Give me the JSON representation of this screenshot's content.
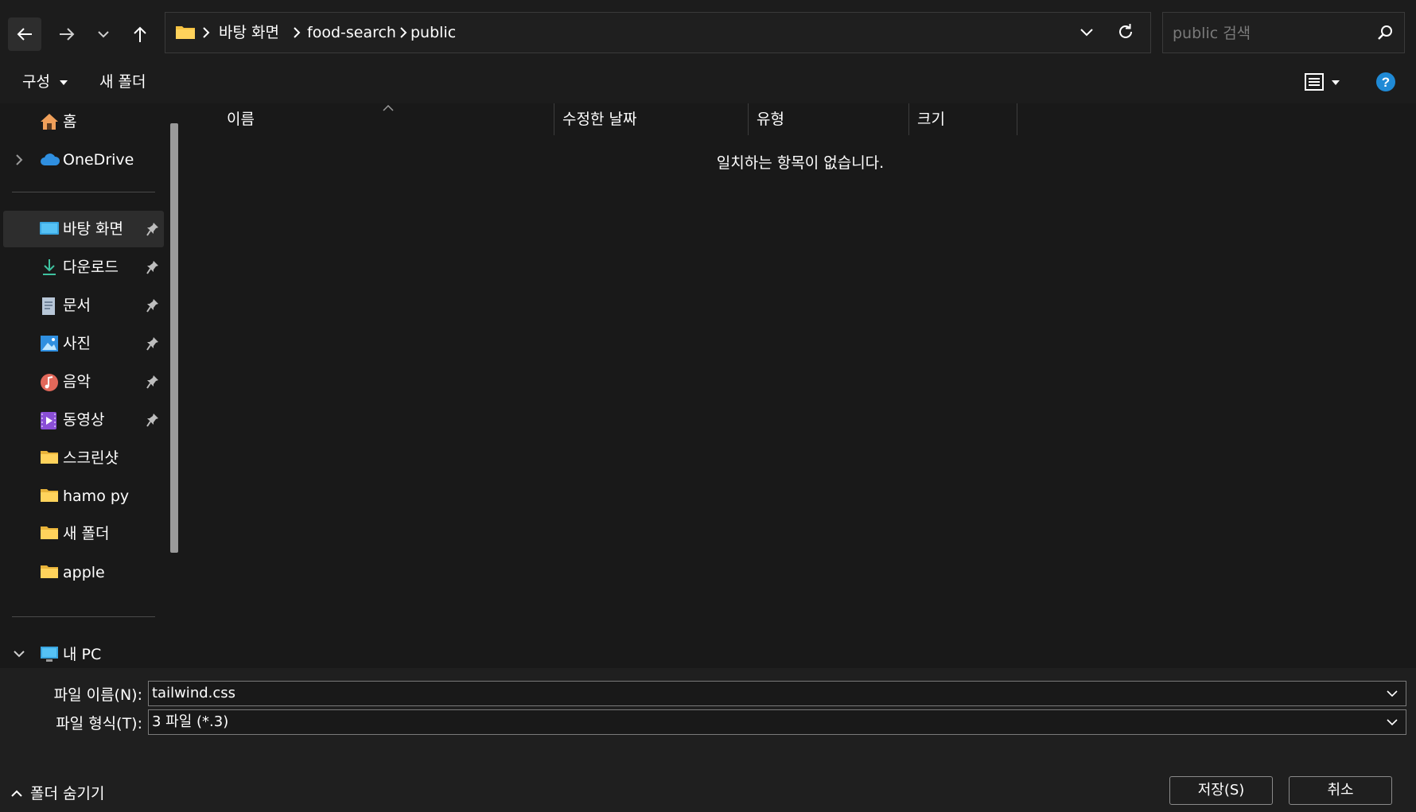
{
  "navigation": {
    "back_icon": "arrow-left-icon",
    "forward_icon": "arrow-right-icon",
    "recent_icon": "chevron-down-icon",
    "up_icon": "arrow-up-icon"
  },
  "address_bar": {
    "breadcrumbs": [
      "바탕 화면",
      "food-search",
      "public"
    ],
    "refresh_icon": "refresh-icon"
  },
  "search": {
    "placeholder": "public 검색",
    "icon": "search-icon"
  },
  "command_bar": {
    "organize_label": "구성",
    "new_folder_label": "새 폴더",
    "view_icon": "list-view-icon",
    "help_icon": "help-icon"
  },
  "sidebar": {
    "home": {
      "label": "홈",
      "icon": "home-icon"
    },
    "onedrive": {
      "label": "OneDrive",
      "icon": "cloud-icon"
    },
    "quick_access": [
      {
        "label": "바탕 화면",
        "icon": "desktop-icon",
        "pinned": true
      },
      {
        "label": "다운로드",
        "icon": "download-icon",
        "pinned": true
      },
      {
        "label": "문서",
        "icon": "document-icon",
        "pinned": true
      },
      {
        "label": "사진",
        "icon": "pictures-icon",
        "pinned": true
      },
      {
        "label": "음악",
        "icon": "music-icon",
        "pinned": true
      },
      {
        "label": "동영상",
        "icon": "video-icon",
        "pinned": true
      },
      {
        "label": "스크린샷",
        "icon": "folder-icon",
        "pinned": false
      },
      {
        "label": "hamo py",
        "icon": "folder-icon",
        "pinned": false
      },
      {
        "label": "새 폴더",
        "icon": "folder-icon",
        "pinned": false
      },
      {
        "label": "apple",
        "icon": "folder-icon",
        "pinned": false
      }
    ],
    "this_pc": {
      "label": "내 PC",
      "icon": "computer-icon"
    }
  },
  "file_list": {
    "columns": [
      "이름",
      "수정한 날짜",
      "유형",
      "크기"
    ],
    "empty_message": "일치하는 항목이 없습니다."
  },
  "save_form": {
    "filename_label": "파일 이름(N):",
    "filename_value": "tailwind.css",
    "filetype_label": "파일 형식(T):",
    "filetype_value": "3 파일 (*.3)"
  },
  "footer": {
    "hide_folders_label": "폴더 숨기기",
    "save_button": "저장(S)",
    "cancel_button": "취소"
  },
  "colors": {
    "background": "#191919",
    "folder_yellow": "#f5c242",
    "help_blue": "#1f8ad6"
  }
}
